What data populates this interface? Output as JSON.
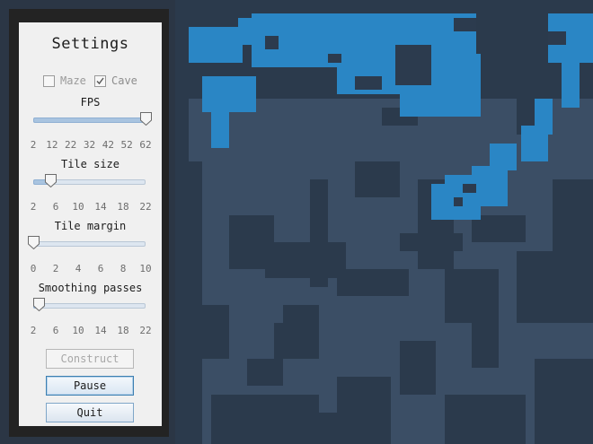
{
  "panel": {
    "title": "Settings",
    "mode_options": [
      {
        "label": "Maze",
        "checked": false
      },
      {
        "label": "Cave",
        "checked": true
      }
    ],
    "sliders": [
      {
        "label": "FPS",
        "ticks": [
          "2",
          "12",
          "22",
          "32",
          "42",
          "52",
          "62"
        ],
        "value": 62,
        "min": 2,
        "max": 62
      },
      {
        "label": "Tile size",
        "ticks": [
          "2",
          "6",
          "10",
          "14",
          "18",
          "22"
        ],
        "value": 5,
        "min": 2,
        "max": 22
      },
      {
        "label": "Tile margin",
        "ticks": [
          "0",
          "2",
          "4",
          "6",
          "8",
          "10"
        ],
        "value": 0,
        "min": 0,
        "max": 10
      },
      {
        "label": "Smoothing passes",
        "ticks": [
          "2",
          "6",
          "10",
          "14",
          "18",
          "22"
        ],
        "value": 3,
        "min": 2,
        "max": 22
      }
    ],
    "buttons": {
      "construct": "Construct",
      "pause": "Pause",
      "quit": "Quit"
    }
  },
  "map": {
    "colors": {
      "background": "#2b3645",
      "floor": "#3b4e65",
      "wall": "#2b3a4c",
      "water": "#2a86c5",
      "island": "#2c3b4e"
    }
  }
}
